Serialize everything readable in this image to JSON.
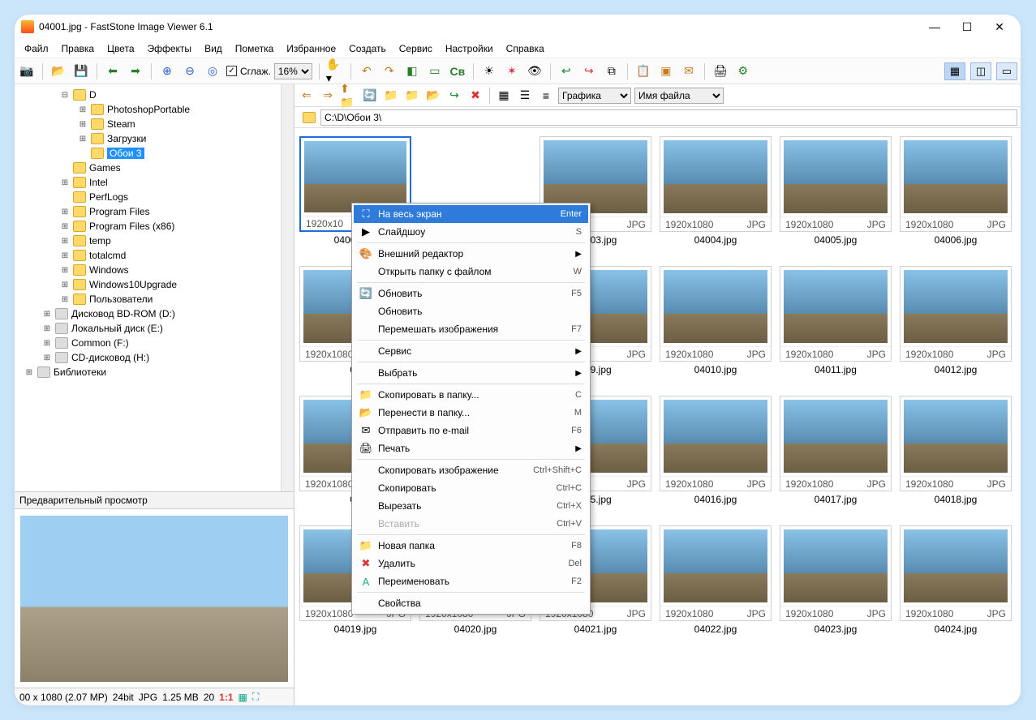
{
  "title": "04001.jpg  -  FastStone Image Viewer 6.1",
  "menubar": [
    "Файл",
    "Правка",
    "Цвета",
    "Эффекты",
    "Вид",
    "Пометка",
    "Избранное",
    "Создать",
    "Сервис",
    "Настройки",
    "Справка"
  ],
  "toolbar": {
    "smooth_label": "Сглаж.",
    "zoom": "16%"
  },
  "tree": [
    {
      "indent": 1,
      "exp": "−",
      "icon": "folder",
      "label": "D"
    },
    {
      "indent": 2,
      "exp": "+",
      "icon": "folder",
      "label": "PhotoshopPortable"
    },
    {
      "indent": 2,
      "exp": "+",
      "icon": "folder",
      "label": "Steam"
    },
    {
      "indent": 2,
      "exp": "+",
      "icon": "folder",
      "label": "Загрузки"
    },
    {
      "indent": 2,
      "exp": "",
      "icon": "folder",
      "label": "Обои 3",
      "sel": true
    },
    {
      "indent": 1,
      "exp": "",
      "icon": "folder",
      "label": "Games"
    },
    {
      "indent": 1,
      "exp": "+",
      "icon": "folder",
      "label": "Intel"
    },
    {
      "indent": 1,
      "exp": "",
      "icon": "folder",
      "label": "PerfLogs"
    },
    {
      "indent": 1,
      "exp": "+",
      "icon": "folder",
      "label": "Program Files"
    },
    {
      "indent": 1,
      "exp": "+",
      "icon": "folder",
      "label": "Program Files (x86)"
    },
    {
      "indent": 1,
      "exp": "+",
      "icon": "folder",
      "label": "temp"
    },
    {
      "indent": 1,
      "exp": "+",
      "icon": "folder",
      "label": "totalcmd"
    },
    {
      "indent": 1,
      "exp": "+",
      "icon": "folder",
      "label": "Windows"
    },
    {
      "indent": 1,
      "exp": "+",
      "icon": "folder",
      "label": "Windows10Upgrade"
    },
    {
      "indent": 1,
      "exp": "+",
      "icon": "folder",
      "label": "Пользователи"
    },
    {
      "indent": 0,
      "exp": "+",
      "icon": "drive",
      "label": "Дисковод BD-ROM (D:)"
    },
    {
      "indent": 0,
      "exp": "+",
      "icon": "drive",
      "label": "Локальный диск (E:)"
    },
    {
      "indent": 0,
      "exp": "+",
      "icon": "drive",
      "label": "Common (F:)"
    },
    {
      "indent": 0,
      "exp": "+",
      "icon": "drive",
      "label": "CD-дисковод (H:)"
    },
    {
      "indent": -1,
      "exp": "+",
      "icon": "lib",
      "label": "Библиотеки"
    }
  ],
  "preview_header": "Предварительный просмотр",
  "statusbar": {
    "res": "00 x 1080 (2.07 MP)",
    "bit": "24bit",
    "fmt": "JPG",
    "size": "1.25 MB",
    "page": "20",
    "scale": "1:1"
  },
  "toolbar2": {
    "group": "Графика",
    "sort": "Имя файла"
  },
  "path": "C:\\D\\Обои 3\\",
  "thumbs": [
    {
      "name": "04001.jpg",
      "res": "1920x10",
      "fmt": "",
      "sel": true
    },
    {
      "name": "",
      "res": "",
      "fmt": "",
      "empty": true
    },
    {
      "name": "04003.jpg",
      "res": "080",
      "fmt": "JPG"
    },
    {
      "name": "04004.jpg",
      "res": "1920x1080",
      "fmt": "JPG"
    },
    {
      "name": "04005.jpg",
      "res": "1920x1080",
      "fmt": "JPG"
    },
    {
      "name": "04006.jpg",
      "res": "1920x1080",
      "fmt": "JPG"
    },
    {
      "name": "04",
      "res": "1920x1080",
      "fmt": "JPG"
    },
    {
      "name": "",
      "res": "",
      "fmt": "",
      "empty": true
    },
    {
      "name": "009.jpg",
      "res": "080",
      "fmt": "JPG"
    },
    {
      "name": "04010.jpg",
      "res": "1920x1080",
      "fmt": "JPG"
    },
    {
      "name": "04011.jpg",
      "res": "1920x1080",
      "fmt": "JPG"
    },
    {
      "name": "04012.jpg",
      "res": "1920x1080",
      "fmt": "JPG"
    },
    {
      "name": "04",
      "res": "1920x1080",
      "fmt": "JPG"
    },
    {
      "name": "",
      "res": "",
      "fmt": "",
      "empty": true
    },
    {
      "name": "015.jpg",
      "res": "080",
      "fmt": "JPG"
    },
    {
      "name": "04016.jpg",
      "res": "1920x1080",
      "fmt": "JPG"
    },
    {
      "name": "04017.jpg",
      "res": "1920x1080",
      "fmt": "JPG"
    },
    {
      "name": "04018.jpg",
      "res": "1920x1080",
      "fmt": "JPG"
    },
    {
      "name": "04019.jpg",
      "res": "1920x1080",
      "fmt": "JPG"
    },
    {
      "name": "04020.jpg",
      "res": "1920x1080",
      "fmt": "JPG"
    },
    {
      "name": "04021.jpg",
      "res": "1920x1080",
      "fmt": "JPG"
    },
    {
      "name": "04022.jpg",
      "res": "1920x1080",
      "fmt": "JPG"
    },
    {
      "name": "04023.jpg",
      "res": "1920x1080",
      "fmt": "JPG"
    },
    {
      "name": "04024.jpg",
      "res": "1920x1080",
      "fmt": "JPG"
    }
  ],
  "context_menu": [
    {
      "icon": "⛶",
      "label": "На весь экран",
      "accel": "Enter",
      "hl": true
    },
    {
      "icon": "▶",
      "label": "Слайдшоу",
      "accel": "S"
    },
    {
      "sep": true
    },
    {
      "icon": "🎨",
      "label": "Внешний редактор",
      "sub": true
    },
    {
      "icon": "",
      "label": "Открыть папку с файлом",
      "accel": "W"
    },
    {
      "sep": true
    },
    {
      "icon": "🔄",
      "label": "Обновить",
      "accel": "F5"
    },
    {
      "icon": "",
      "label": "Обновить",
      "accel": ""
    },
    {
      "icon": "",
      "label": "Перемешать изображения",
      "accel": "F7"
    },
    {
      "sep": true
    },
    {
      "icon": "",
      "label": "Сервис",
      "sub": true
    },
    {
      "sep": true
    },
    {
      "icon": "",
      "label": "Выбрать",
      "sub": true
    },
    {
      "sep": true
    },
    {
      "icon": "📁",
      "label": "Скопировать в папку...",
      "accel": "C"
    },
    {
      "icon": "📂",
      "label": "Перенести в папку...",
      "accel": "M"
    },
    {
      "icon": "✉",
      "label": "Отправить по e-mail",
      "accel": "F6"
    },
    {
      "icon": "🖨",
      "label": "Печать",
      "sub": true
    },
    {
      "sep": true
    },
    {
      "icon": "",
      "label": "Скопировать изображение",
      "accel": "Ctrl+Shift+C"
    },
    {
      "icon": "",
      "label": "Скопировать",
      "accel": "Ctrl+C"
    },
    {
      "icon": "",
      "label": "Вырезать",
      "accel": "Ctrl+X"
    },
    {
      "icon": "",
      "label": "Вставить",
      "accel": "Ctrl+V",
      "dis": true
    },
    {
      "sep": true
    },
    {
      "icon": "📁",
      "label": "Новая папка",
      "accel": "F8"
    },
    {
      "icon": "✖",
      "label": "Удалить",
      "accel": "Del",
      "iconcolor": "#d33"
    },
    {
      "icon": "A",
      "label": "Переименовать",
      "accel": "F2",
      "iconcolor": "#2a8"
    },
    {
      "sep": true
    },
    {
      "icon": "",
      "label": "Свойства",
      "accel": ""
    }
  ]
}
